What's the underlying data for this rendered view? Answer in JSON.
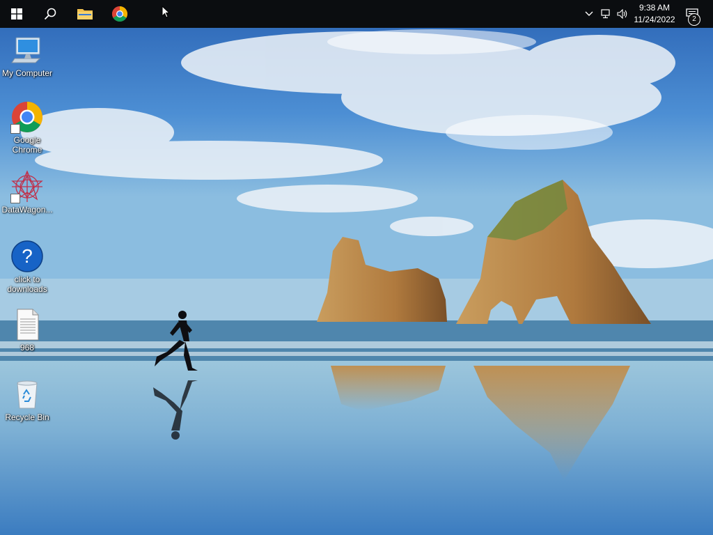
{
  "taskbar": {
    "start_icon": "windows-logo-icon",
    "search_icon": "search-icon",
    "pinned": [
      {
        "name": "file-explorer",
        "icon": "folder-icon"
      },
      {
        "name": "chrome",
        "icon": "chrome-icon"
      }
    ],
    "tray": {
      "chevron_icon": "chevron-up-icon",
      "network_icon": "network-icon",
      "volume_icon": "volume-icon",
      "time": "9:38 AM",
      "date": "11/24/2022",
      "notifications_icon": "notification-icon",
      "notification_count": "2"
    }
  },
  "desktop": {
    "icons": [
      {
        "label": "My Computer",
        "icon": "computer-icon"
      },
      {
        "label": "Google Chrome",
        "icon": "chrome-icon",
        "shortcut": true
      },
      {
        "label": "DataWagon...",
        "icon": "datawagon-icon",
        "shortcut": true
      },
      {
        "label": "click to downloads",
        "icon": "help-icon"
      },
      {
        "label": "968",
        "icon": "document-icon"
      },
      {
        "label": "Recycle Bin",
        "icon": "recycle-bin-icon"
      }
    ]
  },
  "colors": {
    "taskbar": "#0b0d10",
    "sky_top": "#2f6fc0",
    "sea": "#6aa0c8",
    "rock": "#b98a4a",
    "chrome_red": "#db4437",
    "chrome_yellow": "#f4b400",
    "chrome_green": "#0f9d58",
    "chrome_blue": "#4285f4"
  }
}
